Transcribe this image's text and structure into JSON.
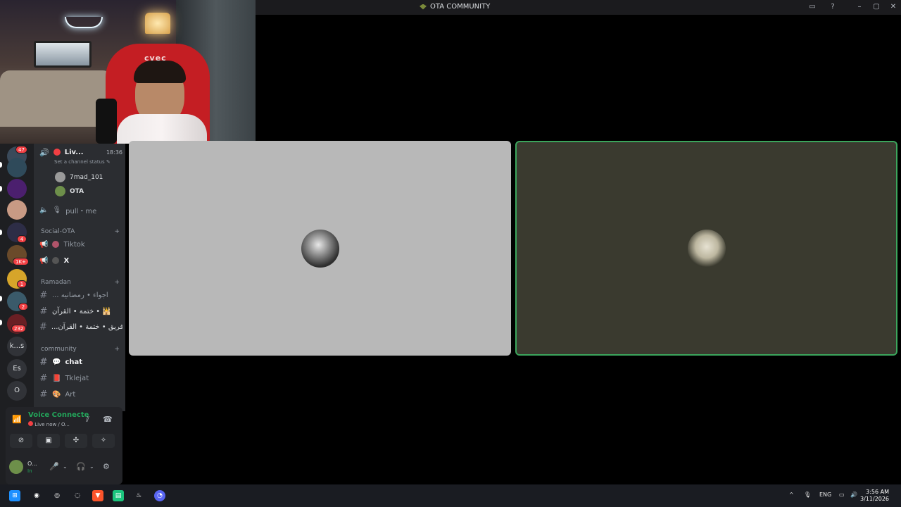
{
  "window": {
    "title": "OTA COMMUNITY"
  },
  "webcam": {
    "chair_text": "cvec"
  },
  "rail": {
    "servers": [
      {
        "label": "",
        "badge": "47"
      },
      {
        "label": "",
        "badge": ""
      },
      {
        "label": "",
        "badge": ""
      },
      {
        "label": "",
        "badge": ""
      },
      {
        "label": "",
        "badge": "4"
      },
      {
        "label": "",
        "badge": "1K+"
      },
      {
        "label": "",
        "badge": "1"
      },
      {
        "label": "",
        "badge": "2"
      },
      {
        "label": "",
        "badge": "232"
      },
      {
        "label": "k...s",
        "badge": ""
      },
      {
        "label": "Es",
        "badge": ""
      },
      {
        "label": "O",
        "badge": ""
      }
    ]
  },
  "channels": {
    "live_channel": {
      "name": "Liv...",
      "time": "18:36",
      "status": "Set a channel status"
    },
    "members": [
      {
        "name": "7mad_101",
        "color": "#9a9a9a"
      },
      {
        "name": "OTA",
        "color": "#6d8f4a"
      }
    ],
    "pull_channel": "pull・me",
    "social_category": "Social-OTA",
    "social_items": [
      {
        "name": "Tiktok"
      },
      {
        "name": "X"
      }
    ],
    "ramadan_category": "Ramadan",
    "ramadan_items": [
      {
        "name": "... اجواء • رمضانيه"
      },
      {
        "name": "ختمة • القرآن • 🕌"
      },
      {
        "name": "...فريق • ختمة • القرآن"
      }
    ],
    "community_category": "community",
    "community_items": [
      {
        "name": "chat"
      },
      {
        "name": "Tklejat"
      },
      {
        "name": "Art"
      }
    ]
  },
  "voice": {
    "title": "Voice Connecte",
    "subtitle": "Live now / O...",
    "user_name": "O...",
    "user_status": "In"
  },
  "taskbar": {
    "lang": "ENG",
    "time": "3:56 AM",
    "date": "3/11/2026"
  },
  "colors": {
    "accent_green": "#23a55a",
    "badge_red": "#f23f43",
    "rail_bg": "#1e1f22",
    "sidebar_bg": "#2b2d31"
  }
}
